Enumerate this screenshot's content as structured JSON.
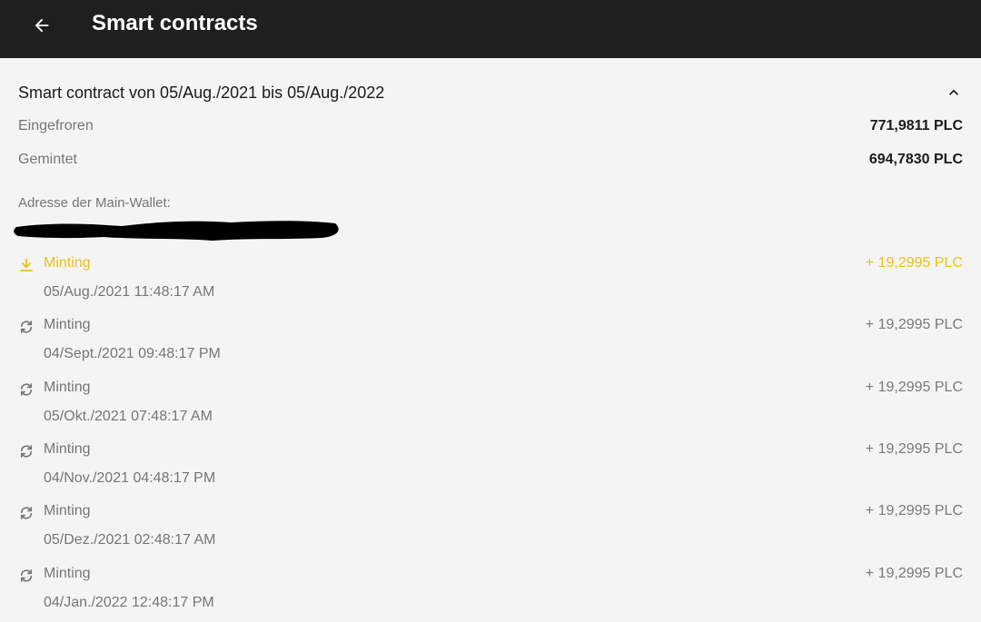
{
  "appbar": {
    "title": "Smart contracts",
    "back_icon": "arrow-left-icon"
  },
  "contract": {
    "title": "Smart contract von 05/Aug./2021 bis 05/Aug./2022",
    "expanded": true,
    "frozen_label": "Eingefroren",
    "frozen_value": "771,9811 PLC",
    "minted_label": "Gemintet",
    "minted_value": "694,7830 PLC",
    "wallet_label": "Adresse der Main-Wallet:"
  },
  "transactions": [
    {
      "label": "Minting",
      "date": "05/Aug./2021 11:48:17 AM",
      "amount": "+ 19,2995 PLC",
      "icon": "download-icon",
      "status": "completed"
    },
    {
      "label": "Minting",
      "date": "04/Sept./2021 09:48:17 PM",
      "amount": "+ 19,2995 PLC",
      "icon": "refresh-icon",
      "status": "pending"
    },
    {
      "label": "Minting",
      "date": "05/Okt./2021 07:48:17 AM",
      "amount": "+ 19,2995 PLC",
      "icon": "refresh-icon",
      "status": "pending"
    },
    {
      "label": "Minting",
      "date": "04/Nov./2021 04:48:17 PM",
      "amount": "+ 19,2995 PLC",
      "icon": "refresh-icon",
      "status": "pending"
    },
    {
      "label": "Minting",
      "date": "05/Dez./2021 02:48:17 AM",
      "amount": "+ 19,2995 PLC",
      "icon": "refresh-icon",
      "status": "pending"
    },
    {
      "label": "Minting",
      "date": "04/Jan./2022 12:48:17 PM",
      "amount": "+ 19,2995 PLC",
      "icon": "refresh-icon",
      "status": "pending"
    }
  ],
  "colors": {
    "appbar_bg": "#1f1f1f",
    "background": "#f4f4f4",
    "accent": "#e9c21b",
    "muted_text": "#767676",
    "primary_text": "#1b1b1b"
  }
}
